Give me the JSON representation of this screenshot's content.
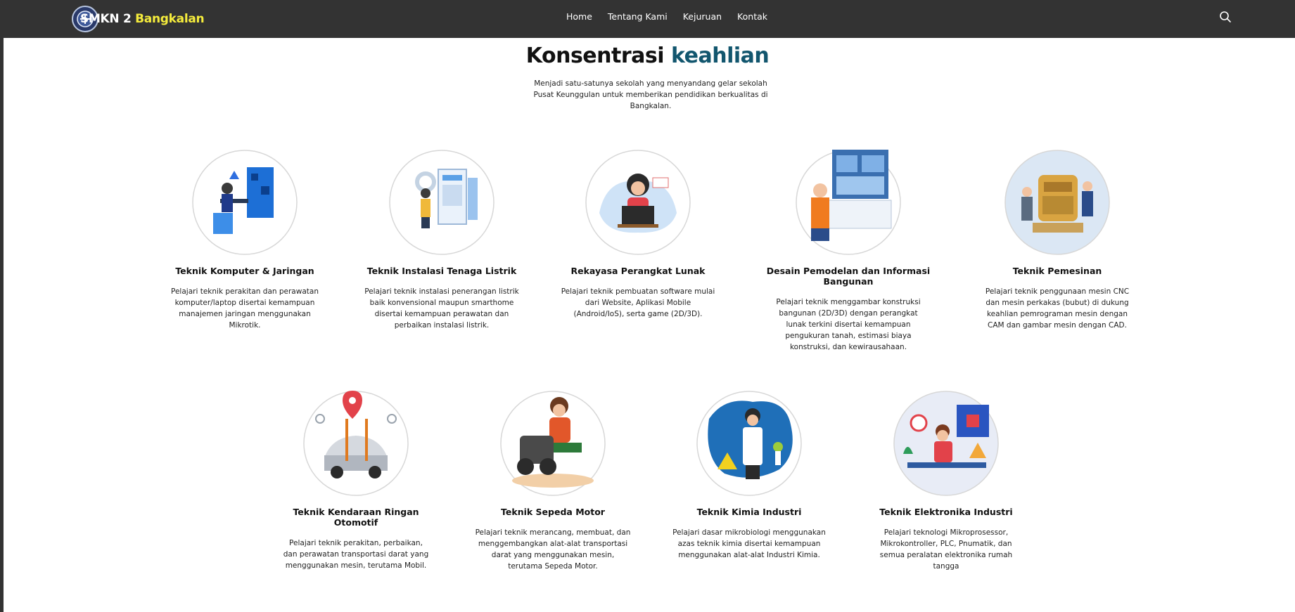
{
  "nav": {
    "logo_part1": "SMKN 2",
    "logo_part2": "Bangkalan",
    "links": [
      "Home",
      "Tentang Kami",
      "Kejuruan",
      "Kontak"
    ]
  },
  "section": {
    "heading_part1": "Konsentrasi",
    "heading_part2": "keahlian",
    "subtitle": "Menjadi satu-satunya sekolah yang menyandang gelar sekolah Pusat Keunggulan untuk memberikan pendidikan berkualitas di Bangkalan."
  },
  "programs": [
    {
      "title": "Teknik Komputer & Jaringan",
      "description": "Pelajari teknik perakitan dan perawatan komputer/laptop disertai kemampuan manajemen jaringan menggunakan Mikrotik."
    },
    {
      "title": "Teknik Instalasi Tenaga Listrik",
      "description": "Pelajari teknik instalasi penerangan listrik baik konvensional maupun smarthome disertai kemampuan perawatan dan perbaikan instalasi listrik."
    },
    {
      "title": "Rekayasa Perangkat Lunak",
      "description": "Pelajari teknik pembuatan software mulai dari Website, Aplikasi Mobile (Android/IoS), serta game (2D/3D)."
    },
    {
      "title": "Desain Pemodelan dan Informasi Bangunan",
      "description": "Pelajari teknik menggambar konstruksi bangunan (2D/3D) dengan perangkat lunak terkini disertai kemampuan pengukuran tanah, estimasi biaya konstruksi, dan kewirausahaan."
    },
    {
      "title": "Teknik Pemesinan",
      "description": "Pelajari teknik penggunaan mesin CNC dan mesin perkakas (bubut) di dukung keahlian pemrograman mesin dengan CAM dan gambar mesin dengan CAD."
    },
    {
      "title": "Teknik Kendaraan Ringan Otomotif",
      "description": "Pelajari teknik perakitan, perbaikan, dan perawatan transportasi darat yang menggunakan mesin, terutama Mobil."
    },
    {
      "title": "Teknik Sepeda Motor",
      "description": "Pelajari teknik merancang, membuat, dan menggembangkan alat-alat transportasi darat yang menggunakan mesin, terutama Sepeda Motor."
    },
    {
      "title": "Teknik Kimia Industri",
      "description": "Pelajari dasar mikrobiologi menggunakan azas teknik kimia disertai kemampuan menggunakan alat-alat Industri Kimia."
    },
    {
      "title": "Teknik Elektronika Industri",
      "description": "Pelajari teknologi Mikroprosessor, Mikrokontroller, PLC, Pnumatik, dan semua peralatan elektronika rumah tangga"
    }
  ],
  "colors": {
    "navbar": "#333333",
    "accent": "#12566e",
    "logo_highlight": "#f5ec3c",
    "page_background": "#ffffff"
  },
  "icons": [
    "logo-emblem-icon",
    "search-icon"
  ]
}
